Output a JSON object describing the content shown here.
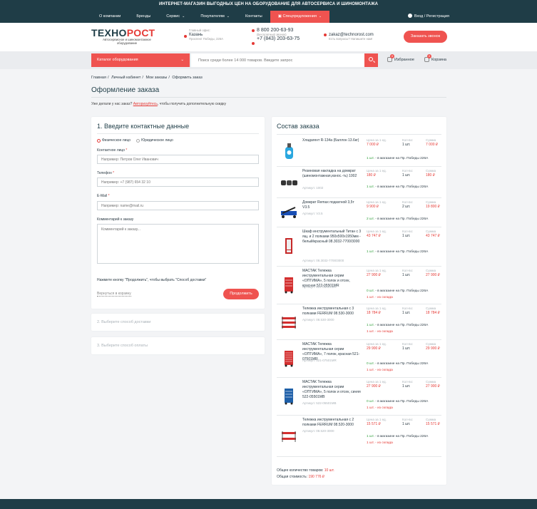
{
  "topbar": {
    "promo": "ИНТЕРНЕТ-МАГАЗИН ВЫГОДНЫХ ЦЕН НА ОБОРУДОВАНИЕ ДЛЯ АВТОСЕРВИСА И ШИНОМОНТАЖА",
    "nav": [
      {
        "label": "О компании"
      },
      {
        "label": "Бренды"
      },
      {
        "label": "Сервис"
      },
      {
        "label": "Покупателям"
      },
      {
        "label": "Контакты"
      },
      {
        "label": "Спецпредложения"
      }
    ],
    "login": "Вход / Регистрация"
  },
  "header": {
    "logo_main": "ТЕХНО",
    "logo_accent": "РОСТ",
    "logo_sub": "Автосервисное и шиномонтажное оборудование",
    "office_label": "Главный офис:",
    "office_city": "Казань",
    "office_address": "Проспект Победы, 226А",
    "phone1": "8 800 200-63-93",
    "phone_note": "(Бесплатный звонок)",
    "phone2": "+7 (843) 203-63-75",
    "email": "zakaz@technorost.com",
    "email_note": "Есть вопросы? Напишите нам!",
    "call_button": "Заказать звонок"
  },
  "searchrow": {
    "catalog_button": "Каталог оборудования",
    "search_placeholder": "Поиск среди более 14 000 товаров. Введите запрос",
    "favorites_label": "Избранное",
    "favorites_count": "0",
    "cart_label": "Корзина",
    "cart_count": "0"
  },
  "breadcrumb": [
    "Главная",
    "Личный кабинет",
    "Мои заказы",
    "Оформить заказ"
  ],
  "page_title": "Оформление заказа",
  "login_note": {
    "before": "Уже делали у нас заказ? ",
    "link": "Авторизуйтесь",
    "after": ", чтобы получить дополнительную скидку"
  },
  "contact_form": {
    "title": "1. Введите контактные данные",
    "radio_individual": "Физическое лицо",
    "radio_legal": "Юридическое лицо",
    "name_label": "Контактное лицо",
    "name_placeholder": "Например: Петров Олег Иванович",
    "phone_label": "Телефон",
    "phone_placeholder": "Например: +7 (987) 654 32 10",
    "email_label": "E-Mail",
    "email_placeholder": "Например: name@mail.ru",
    "comment_label": "Комментарий к заказу",
    "comment_placeholder": "Комментарий к заказу...",
    "hint": "Нажмите кнопку \"Продолжить\", чтобы выбрать \"Способ доставки\"",
    "back_link": "Вернуться в корзину",
    "continue_button": "Продолжить"
  },
  "steps": [
    {
      "label": "2. Выберите способ доставки"
    },
    {
      "label": "3. Выберите способ оплаты"
    }
  ],
  "order": {
    "title": "Состав заказа",
    "col_price": "Цена за 1 ед.",
    "col_qty": "Кол-во:",
    "col_sum": "Сумма",
    "items": [
      {
        "name": "Хладагент R-134a (Баллон 13.6кг)",
        "article": "",
        "price": "7 000 ₽",
        "qty": "1 шт.",
        "sum": "7 000 ₽",
        "stock_count": "1 шт.",
        "stock_text": " - в магазине на Пр. Победы 226А",
        "stock_ok": true,
        "stock2": ""
      },
      {
        "name": "Резиновая накладка на домкрат (шиномонтажная,износ.-ть) 1002",
        "article": "Артикул: 1002",
        "price": "180 ₽",
        "qty": "1 шт.",
        "sum": "180 ₽",
        "stock_count": "1 шт.",
        "stock_text": " - в магазине на Пр. Победы 226А",
        "stock_ok": true,
        "stock2": ""
      },
      {
        "name": "Домкрат Remax подкатной 3,5т V3.5",
        "article": "Артикул: V3.5",
        "price": "9 900 ₽",
        "qty": "2 шт.",
        "sum": "19 800 ₽",
        "stock_count": "2 шт.",
        "stock_text": " - в магазине на Пр. Победы 226А",
        "stock_ok": true,
        "stock2": ""
      },
      {
        "name": "Шкаф инструментальный Титан с 3 ящ. и 2 полками 950х500х1950мм - белый/красный 08.3032-7700/3000",
        "article": "Артикул: 08.3032-7700/3000",
        "price": "43 747 ₽",
        "qty": "1 шт.",
        "sum": "43 747 ₽",
        "stock_count": "1 шт.",
        "stock_text": " - в магазине на Пр. Победы 226А",
        "stock_ok": true,
        "stock2": ""
      },
      {
        "name": "МАСТАК Тележка инструментальная серии «ОПТИМА», 5 полок и отсек, красная 522-05501MR",
        "article": "Артикул: 522-05501MR",
        "price": "27 900 ₽",
        "qty": "1 шт.",
        "sum": "27 900 ₽",
        "stock_count": "0 шт.",
        "stock_text": " - в магазине на Пр. Победы 226А",
        "stock_ok": false,
        "stock2": "1 шт. - из склада"
      },
      {
        "name": "Тележка инструментальная с 3 полками FERRUM 08.530-3000",
        "article": "Артикул: 08.530-3000",
        "price": "18 784 ₽",
        "qty": "1 шт.",
        "sum": "18 784 ₽",
        "stock_count": "1 шт.",
        "stock_text": " - в магазине на Пр. Победы 226А",
        "stock_ok": true,
        "stock2": "1 шт. - из склада"
      },
      {
        "name": "МАСТАК Тележка инструментальная серии «ОПТИМА», 7 полок, красная 521-07501MR",
        "article": "Артикул: 521-07501MR",
        "price": "29 900 ₽",
        "qty": "1 шт.",
        "sum": "29 900 ₽",
        "stock_count": "0 шт.",
        "stock_text": " - в магазине на Пр. Победы 226А",
        "stock_ok": false,
        "stock2": "1 шт. - из склада"
      },
      {
        "name": "МАСТАК Тележка инструментальная серии «ОПТИМА», 5 полок и отсек, синяя 522-05501MB",
        "article": "Артикул: 522-05501MB",
        "price": "27 900 ₽",
        "qty": "1 шт.",
        "sum": "27 900 ₽",
        "stock_count": "0 шт.",
        "stock_text": " - в магазине на Пр. Победы 226А",
        "stock_ok": false,
        "stock2": "1 шт. - из склада"
      },
      {
        "name": "Тележка инструментальная с 2 полками FERRUM 08.520-3000",
        "article": "Артикул: 08.520-3000",
        "price": "15 571 ₽",
        "qty": "1 шт.",
        "sum": "15 571 ₽",
        "stock_count": "1 шт.",
        "stock_text": " - в магазине на Пр. Победы 226А",
        "stock_ok": true,
        "stock2": "1 шт. - из склада"
      }
    ],
    "total_qty_label": "Общее количество товаров: ",
    "total_qty_value": "10 шт.",
    "total_sum_label": "Общая стоимость: ",
    "total_sum_value": "190 776 ₽"
  },
  "colors": {
    "accent": "#ef5350",
    "dark": "#1f3d47",
    "green": "#2e9e3a"
  }
}
